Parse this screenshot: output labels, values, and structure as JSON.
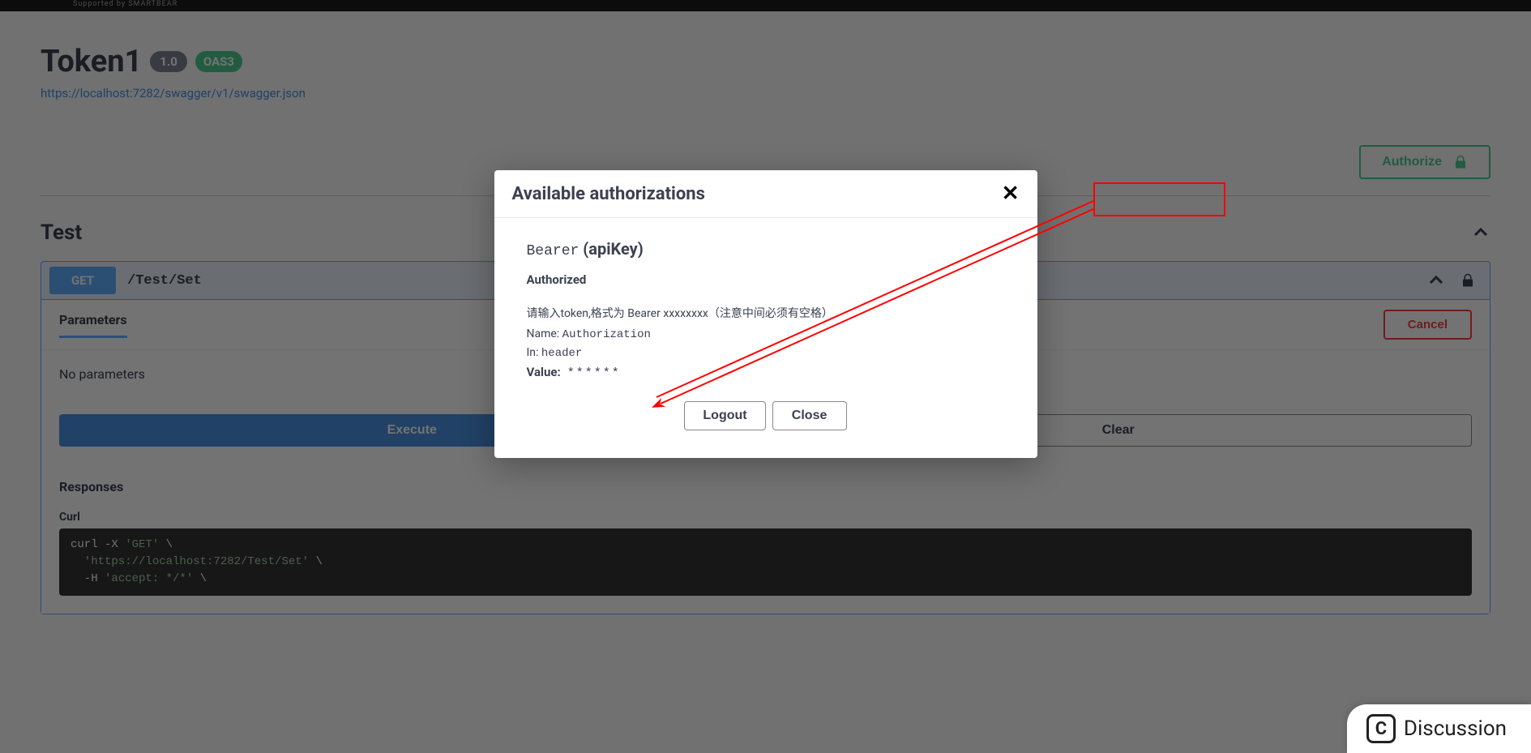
{
  "topbar": {
    "supported_by": "Supported by SMARTBEAR"
  },
  "info": {
    "title": "Token1",
    "version": "1.0",
    "oas_badge": "OAS3",
    "spec_url": "https://localhost:7282/swagger/v1/swagger.json"
  },
  "authorize_button": "Authorize",
  "tag": {
    "name": "Test"
  },
  "operation": {
    "method": "GET",
    "path": "/Test/Set",
    "parameters_heading": "Parameters",
    "cancel_button": "Cancel",
    "no_parameters": "No parameters",
    "execute_button": "Execute",
    "clear_button": "Clear",
    "responses_heading": "Responses",
    "curl_label": "Curl",
    "curl_lines": {
      "l1_cmd": "curl -X ",
      "l1_str": "'GET'",
      "l1_tail": " \\",
      "l2_str": "  'https://localhost:7282/Test/Set'",
      "l2_tail": " \\",
      "l3_cmd": "  -H ",
      "l3_str": "'accept: */*'",
      "l3_tail": " \\"
    }
  },
  "modal": {
    "title": "Available authorizations",
    "close_glyph": "✕",
    "scheme_code": "Bearer",
    "scheme_type": " (apiKey)",
    "status": "Authorized",
    "description": "请输入token,格式为 Bearer xxxxxxxx（注意中间必须有空格）",
    "name_label": "Name: ",
    "name_value": "Authorization",
    "in_label": "In: ",
    "in_value": "header",
    "value_label": "Value:",
    "value_masked": "******",
    "logout_button": "Logout",
    "close_button": "Close"
  },
  "discussion": {
    "badge_letter": "C",
    "label": "Discussion"
  }
}
